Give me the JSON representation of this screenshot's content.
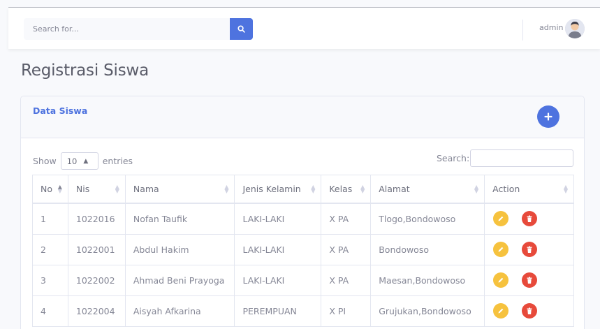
{
  "topbar": {
    "search_placeholder": "Search for...",
    "username": "admin"
  },
  "page": {
    "title": "Registrasi Siswa"
  },
  "card": {
    "title": "Data Siswa"
  },
  "table_controls": {
    "show_label": "Show",
    "entries_value": "10",
    "entries_label": "entries",
    "search_label": "Search:"
  },
  "table": {
    "headers": [
      "No",
      "Nis",
      "Nama",
      "Jenis Kelamin",
      "Kelas",
      "Alamat",
      "Action"
    ],
    "rows": [
      {
        "no": "1",
        "nis": "1022016",
        "nama": "Nofan Taufik",
        "jk": "LAKI-LAKI",
        "kelas": "X PA",
        "alamat": "Tlogo,Bondowoso"
      },
      {
        "no": "2",
        "nis": "1022001",
        "nama": "Abdul Hakim",
        "jk": "LAKI-LAKI",
        "kelas": "X PA",
        "alamat": "Bondowoso"
      },
      {
        "no": "3",
        "nis": "1022002",
        "nama": "Ahmad Beni Prayoga",
        "jk": "LAKI-LAKI",
        "kelas": "X PA",
        "alamat": "Maesan,Bondowoso"
      },
      {
        "no": "4",
        "nis": "1022004",
        "nama": "Aisyah Afkarina",
        "jk": "PEREMPUAN",
        "kelas": "X PI",
        "alamat": "Grujukan,Bondowoso"
      }
    ]
  },
  "colors": {
    "primary": "#4e73df",
    "warning": "#f6c23e",
    "danger": "#e74a3b"
  },
  "icons": {
    "search": "search-icon",
    "add": "plus-icon",
    "edit": "pencil-icon",
    "delete": "trash-icon"
  }
}
